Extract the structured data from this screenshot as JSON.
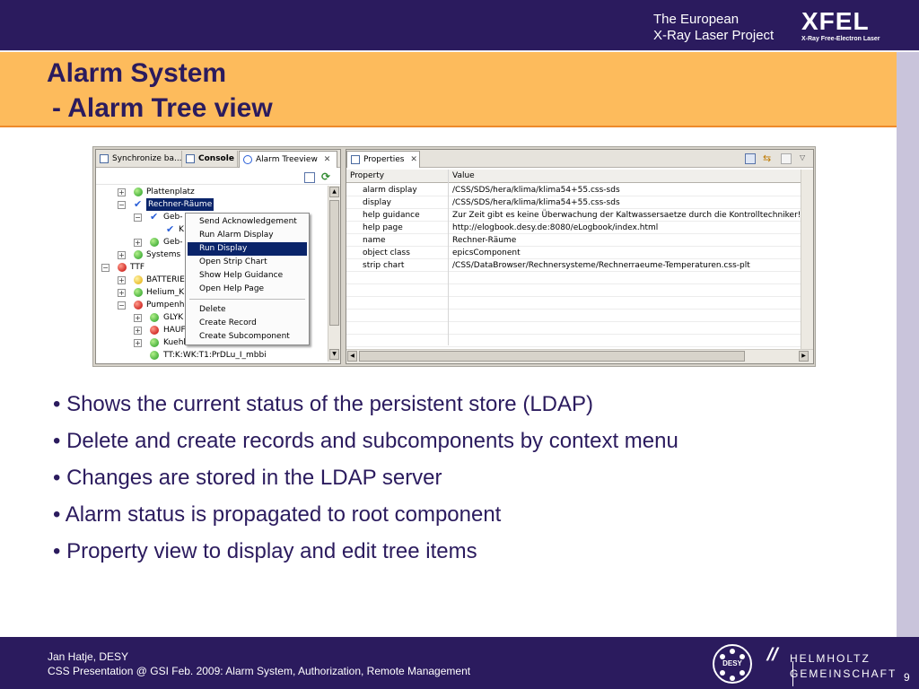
{
  "header": {
    "org_line1": "The European",
    "org_line2": "X-Ray Laser Project",
    "logo_word": "XFEL",
    "logo_sub": "X-Ray Free-Electron Laser"
  },
  "title": {
    "line1": "Alarm System",
    "line2": "- Alarm Tree view"
  },
  "left_pane": {
    "tabs": [
      {
        "label": "Synchronize ba..."
      },
      {
        "label": "Console"
      },
      {
        "label": "Alarm Treeview"
      }
    ],
    "tree": [
      {
        "label": "Plattenplatz",
        "status": "green"
      },
      {
        "label": "Rechner-Räume",
        "status": "check"
      },
      {
        "label": "Geb-",
        "status": "check"
      },
      {
        "label": "K",
        "status": "check"
      },
      {
        "label": "Geb-",
        "status": "green"
      },
      {
        "label": "Systems",
        "status": "green"
      },
      {
        "label": "TTF",
        "status": "red"
      },
      {
        "label": "BATTERIE",
        "status": "yellow"
      },
      {
        "label": "Helium_K",
        "status": "green"
      },
      {
        "label": "Pumpenh",
        "status": "red"
      },
      {
        "label": "GLYK",
        "status": "green"
      },
      {
        "label": "HAUF",
        "status": "red"
      },
      {
        "label": "Kuehlturmkreis",
        "status": "green"
      },
      {
        "label": "TT:K:WK:T1:PrDLu_I_mbbi",
        "status": "green"
      }
    ],
    "context_menu": [
      "Send Acknowledgement",
      "Run Alarm Display",
      "Run Display",
      "Open Strip Chart",
      "Show Help Guidance",
      "Open Help Page",
      "Delete",
      "Create Record",
      "Create Subcomponent"
    ]
  },
  "right_pane": {
    "tab": "Properties",
    "columns": [
      "Property",
      "Value"
    ],
    "rows": [
      {
        "k": "alarm display",
        "v": "/CSS/SDS/hera/klima/klima54+55.css-sds"
      },
      {
        "k": "display",
        "v": "/CSS/SDS/hera/klima/klima54+55.css-sds"
      },
      {
        "k": "help guidance",
        "v": "Zur Zeit gibt es keine Überwachung der Kaltwassersaetze durch die Kontrolltechniker!"
      },
      {
        "k": "help page",
        "v": "http://elogbook.desy.de:8080/eLogbook/index.html"
      },
      {
        "k": "name",
        "v": "Rechner-Räume"
      },
      {
        "k": "object class",
        "v": "epicsComponent"
      },
      {
        "k": "strip chart",
        "v": "/CSS/DataBrowser/Rechnersysteme/Rechnerraeume-Temperaturen.css-plt"
      }
    ]
  },
  "bullets": [
    "• Shows the current status of the persistent store (LDAP)",
    "• Delete and create records and subcomponents by context menu",
    "• Changes are stored in the LDAP server",
    "• Alarm status is propagated to root component",
    "• Property view to display and edit tree items"
  ],
  "footer": {
    "line1": "Jan Hatje, DESY",
    "line2": "CSS Presentation @ GSI Feb. 2009: Alarm System, Authorization, Remote Management",
    "desy": "DESY",
    "helm1": "HELMHOLTZ",
    "helm2": "GEMEINSCHAFT",
    "page": "9"
  }
}
